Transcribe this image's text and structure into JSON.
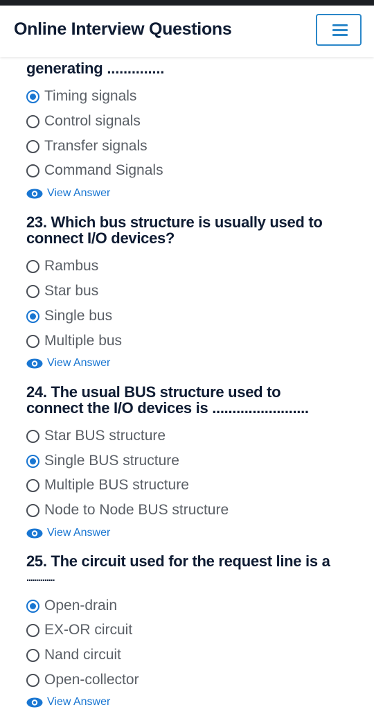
{
  "header": {
    "brand": "Online Interview Questions",
    "menu_icon": "hamburger-icon"
  },
  "colors": {
    "accent": "#1976d2",
    "menu_border": "#2b87c9",
    "title": "#0f1c33",
    "option_text": "#5a5f66"
  },
  "partial_question": {
    "tail": "generating ..............",
    "options": [
      "Timing signals",
      "Control signals",
      "Transfer signals",
      "Command Signals"
    ],
    "selected": 0,
    "view_answer": "View Answer"
  },
  "questions": [
    {
      "title_line1": "23. Which bus structure is usually used to",
      "title_line2": "connect I/O devices?",
      "options": [
        "Rambus",
        "Star bus",
        "Single bus",
        "Multiple bus"
      ],
      "selected": 2,
      "view_answer": "View Answer"
    },
    {
      "title_line1": "24. The usual BUS structure used to",
      "title_line2": "connect the I/O devices is ........................",
      "options": [
        "Star BUS structure",
        "Single BUS structure",
        "Multiple BUS structure",
        "Node to Node BUS structure"
      ],
      "selected": 1,
      "view_answer": "View Answer"
    },
    {
      "title_line1": "25. The circuit used for the request line is a",
      "title_line2": "..............",
      "options": [
        "Open-drain",
        "EX-OR circuit",
        "Nand circuit",
        "Open-collector"
      ],
      "selected": 0,
      "view_answer": "View Answer"
    }
  ]
}
